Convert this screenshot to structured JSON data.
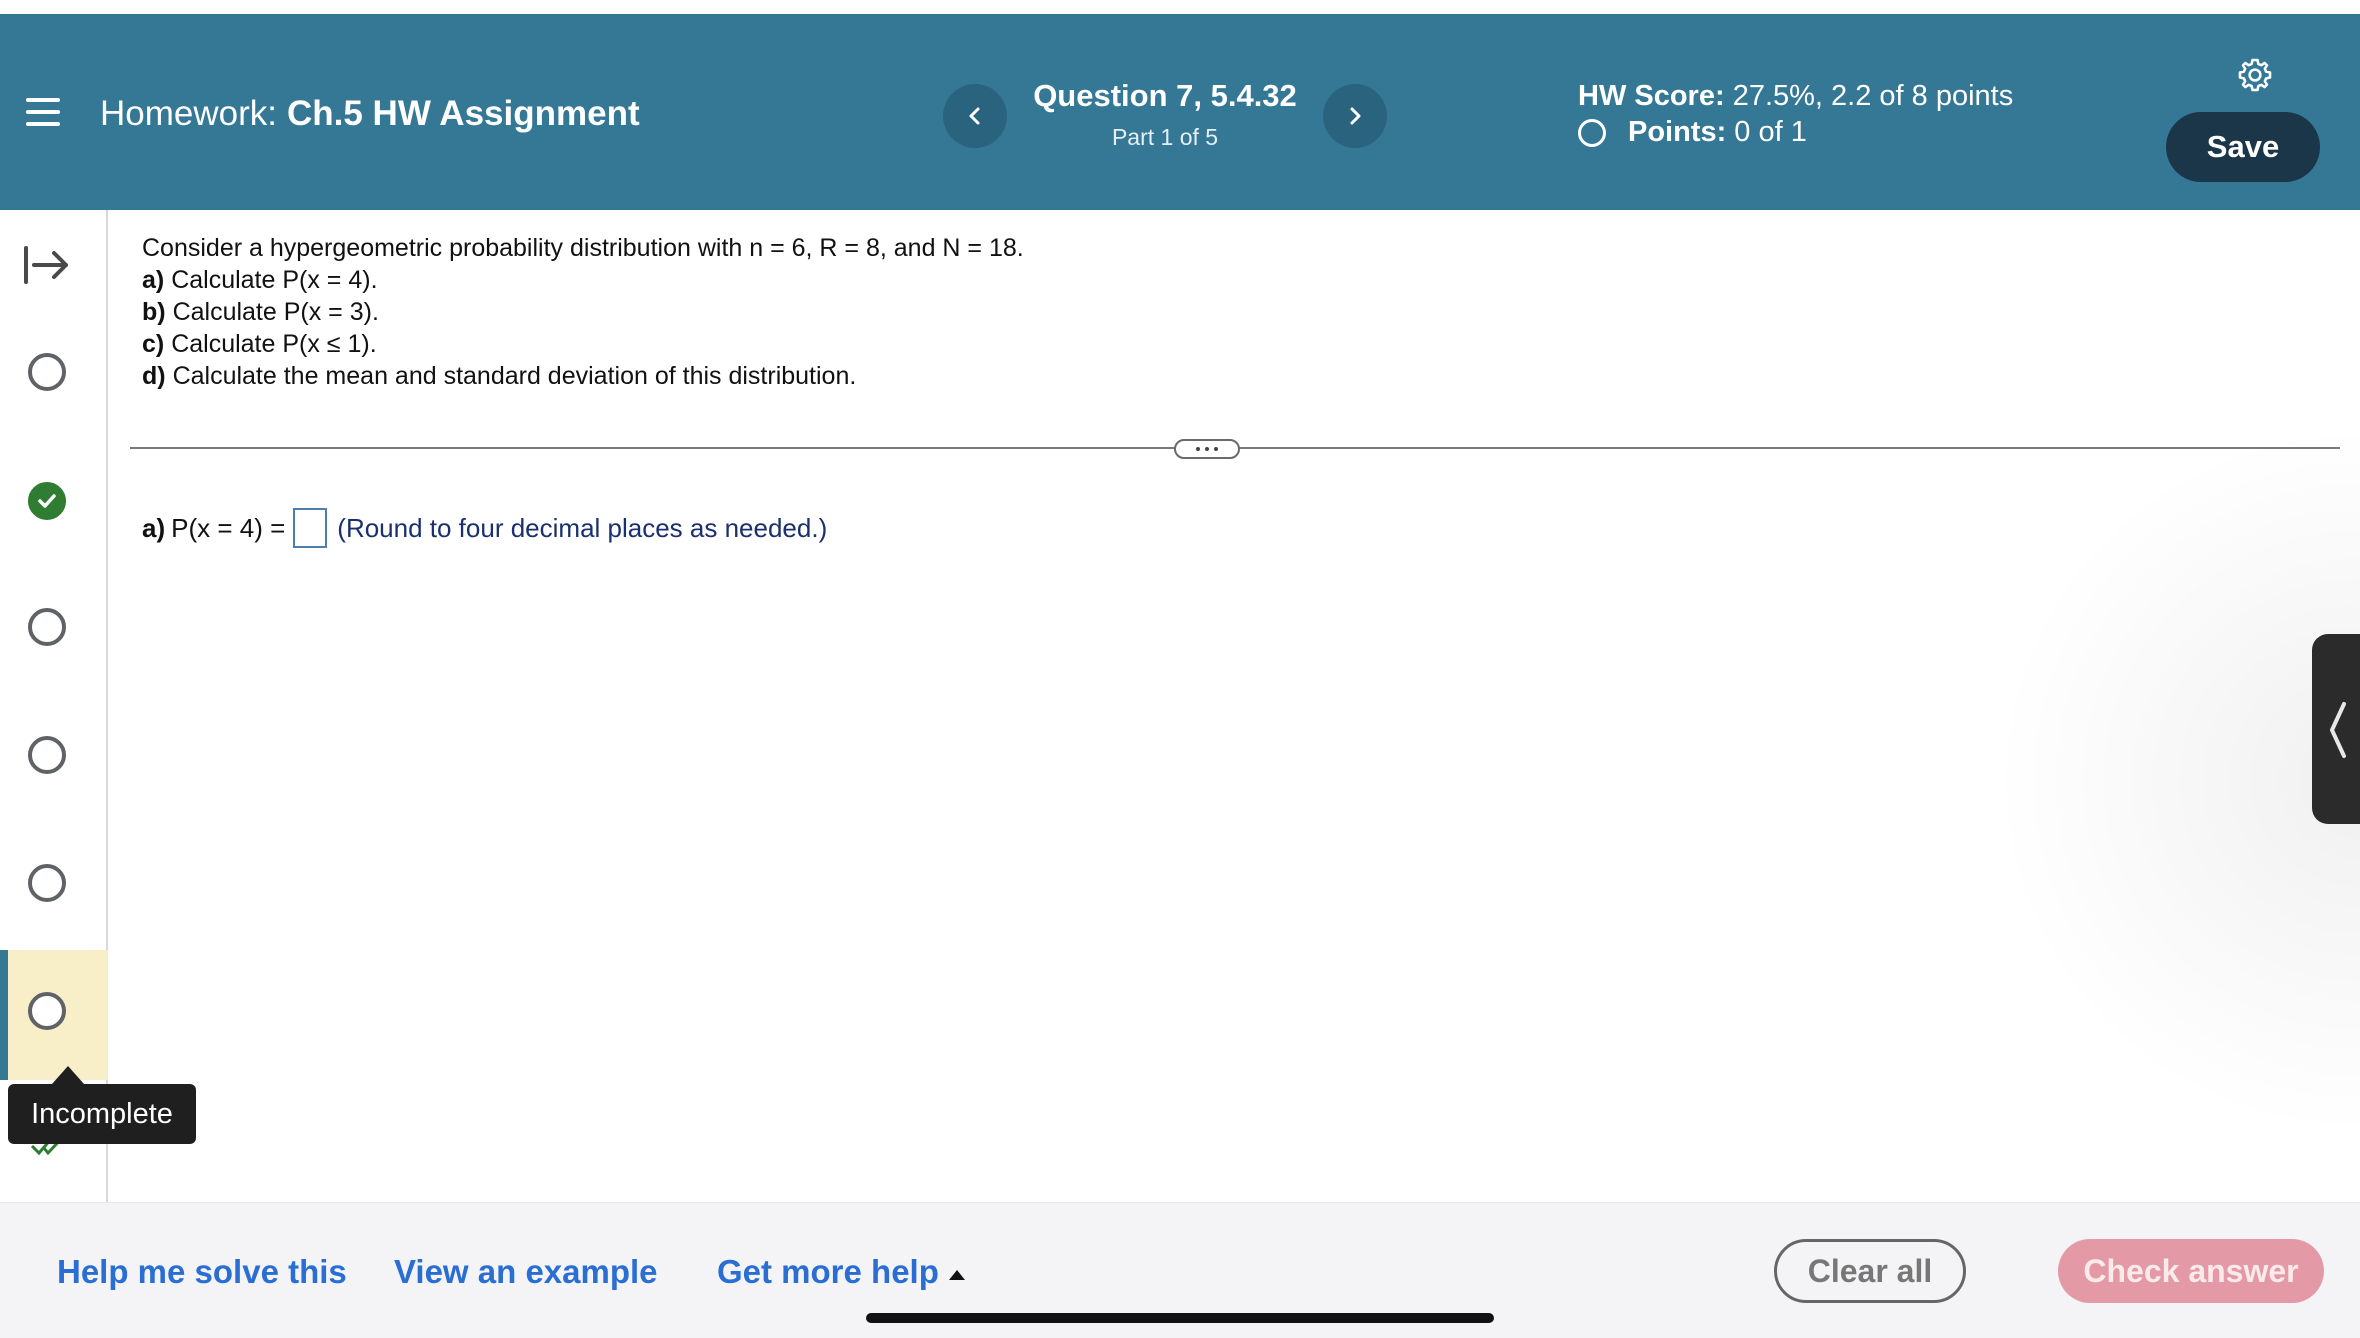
{
  "header": {
    "prefix": "Homework:",
    "assignment": "Ch.5 HW Assignment",
    "question_title": "Question 7, 5.4.32",
    "part": "Part 1 of 5",
    "score_label": "HW Score:",
    "score_value": "27.5%, 2.2 of 8 points",
    "points_label": "Points:",
    "points_value": "0 of 1",
    "save_label": "Save",
    "icons": {
      "menu": "menu-icon",
      "prev": "chevron-left-icon",
      "next": "chevron-right-icon",
      "settings": "gear-icon"
    },
    "colors": {
      "header_bg": "#357896",
      "save_bg": "#1b3648"
    }
  },
  "sidebar": {
    "questions": [
      {
        "status": "unanswered"
      },
      {
        "status": "correct"
      },
      {
        "status": "unanswered"
      },
      {
        "status": "unanswered"
      },
      {
        "status": "unanswered"
      },
      {
        "status": "current"
      }
    ],
    "tooltip": "Incomplete"
  },
  "problem": {
    "intro": "Consider a hypergeometric probability distribution with n = 6, R = 8, and N = 18.",
    "parts": [
      {
        "label": "a)",
        "text": "Calculate P(x = 4)."
      },
      {
        "label": "b)",
        "text": "Calculate P(x = 3)."
      },
      {
        "label": "c)",
        "text": "Calculate P(x ≤ 1)."
      },
      {
        "label": "d)",
        "text": "Calculate the mean and standard deviation of this distribution."
      }
    ]
  },
  "answer": {
    "label": "a)",
    "expression": "P(x = 4) =",
    "value": "",
    "hint": "(Round to four decimal places as needed.)"
  },
  "footer": {
    "help_me_solve": "Help me solve this",
    "view_example": "View an example",
    "get_more_help": "Get more help",
    "clear_all": "Clear all",
    "check_answer": "Check answer",
    "colors": {
      "link": "#2a6ed4",
      "check_bg": "#e49aa6"
    }
  }
}
